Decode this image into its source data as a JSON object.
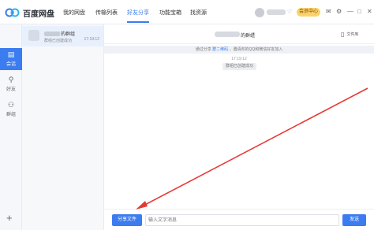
{
  "app": {
    "name": "百度网盘",
    "brand_color": "#3b7cf0"
  },
  "nav": {
    "items": [
      {
        "label": "我的网盘",
        "active": false
      },
      {
        "label": "传输列表",
        "active": false
      },
      {
        "label": "好友分享",
        "active": true
      },
      {
        "label": "功能宝箱",
        "active": false
      },
      {
        "label": "找资源",
        "active": false
      }
    ]
  },
  "user": {
    "vip_badge": "会员中心",
    "icons": [
      "vip-diamond-icon",
      "envelope-icon",
      "gear-icon"
    ]
  },
  "rail": {
    "items": [
      {
        "label": "会话",
        "icon": "chat-icon",
        "active": true
      },
      {
        "label": "好友",
        "icon": "person-icon",
        "active": false
      },
      {
        "label": "群组",
        "icon": "group-icon",
        "active": false
      }
    ],
    "add_icon": "plus-icon"
  },
  "conversations": [
    {
      "name": "的群组",
      "last_message": "群组已创建成功",
      "time": "17:19:12"
    }
  ],
  "chat": {
    "title": "的群组",
    "file_library": "文件库",
    "notice_prefix": "通过分享",
    "notice_link": "群二维码",
    "notice_suffix": "，邀请你的QQ和微信好友加入",
    "message_time": "17:19:12",
    "system_message": "群组已创建成功",
    "share_button": "分享文件",
    "input_placeholder": "输入文字消息",
    "send_button": "发送"
  },
  "annotation": {
    "color": "#e53935"
  }
}
